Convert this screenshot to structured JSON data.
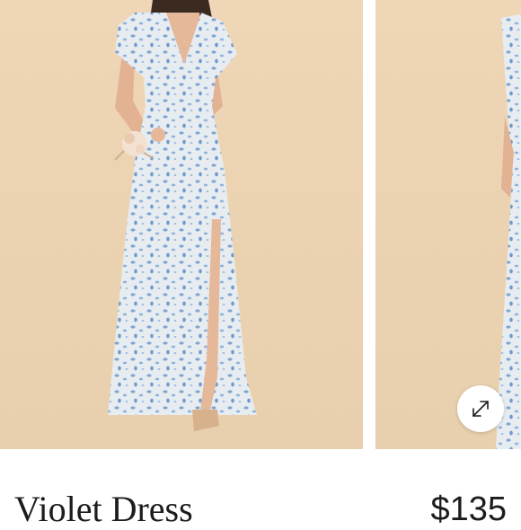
{
  "product": {
    "name": "Violet Dress",
    "price": "$135"
  },
  "gallery": {
    "images": [
      {
        "name": "product-image-front"
      },
      {
        "name": "product-image-side"
      }
    ],
    "expand_icon": "expand-arrows-icon"
  },
  "colors": {
    "backdrop": "#ecd4b4",
    "dress_base": "#e7ecf1",
    "dress_print": "#7ea6d2",
    "text": "#1c1c1c"
  }
}
